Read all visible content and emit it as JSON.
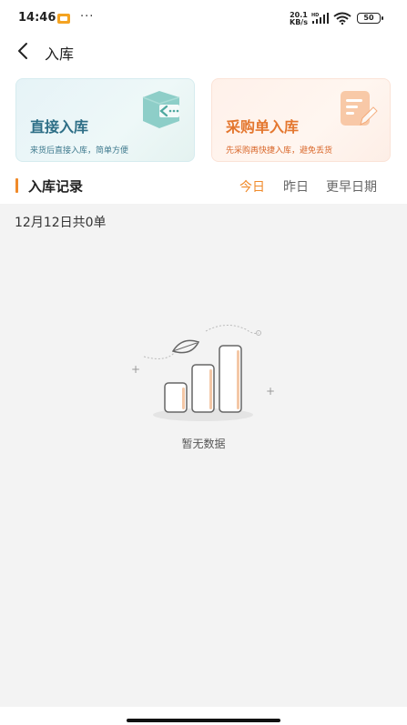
{
  "status_bar": {
    "time": "14:46",
    "notification_icon": "gallery-notification-icon",
    "more": "···",
    "net_speed_value": "20.1",
    "net_speed_unit": "KB/s",
    "signal_label": "HD",
    "battery": "50"
  },
  "nav": {
    "back_icon": "chevron-left-icon",
    "title": "入库"
  },
  "cards": {
    "direct": {
      "title": "直接入库",
      "subtitle": "来货后直接入库，简单方便",
      "icon": "inbound-box-arrow-icon",
      "color": "#2d6e86"
    },
    "purchase": {
      "title": "采购单入库",
      "subtitle": "先采购再快捷入库，避免丢货",
      "icon": "purchase-order-edit-icon",
      "color": "#e4772f"
    }
  },
  "records": {
    "title": "入库记录",
    "accent_color": "#f08a2a",
    "tabs": [
      {
        "label": "今日",
        "selected": true
      },
      {
        "label": "昨日",
        "selected": false
      },
      {
        "label": "更早日期",
        "selected": false
      }
    ],
    "summary": "12月12日共0单",
    "empty_text": "暂无数据",
    "empty_icon": "empty-bar-chart-leaf-icon"
  }
}
